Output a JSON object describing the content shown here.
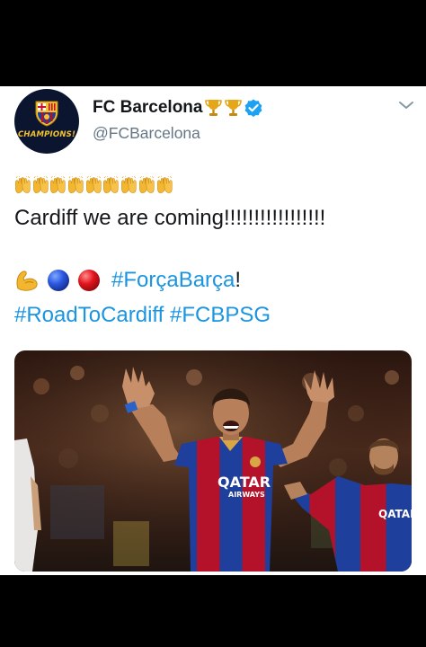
{
  "tweet": {
    "author": {
      "display_name": "FC Barcelona",
      "handle": "@FCBarcelona",
      "avatar_text": "CHAMPIONS!",
      "avatar_icon": "fc-barcelona-crest",
      "badges": [
        "trophy-icon",
        "trophy-icon",
        "verified-icon"
      ]
    },
    "menu_icon": "chevron-down-icon",
    "text": {
      "line1": "Cardiff we are coming!!!!!!!!!!!!!!!!!",
      "emojis": [
        "flexed-biceps-icon",
        "blue-circle-icon",
        "red-circle-icon"
      ],
      "hashtag1": "#ForçaBarça",
      "hashtag1_suffix": "!",
      "hashtag2": "#RoadToCardiff",
      "hashtag3": "#FCBPSG",
      "raised_hands_count": 9
    },
    "media": {
      "sponsor_text": "QATAR",
      "sponsor_sub": "AIRWAYS",
      "sponsor_text_2": "QATAR"
    }
  },
  "colors": {
    "background": "#000000",
    "card": "#ffffff",
    "name": "#14171a",
    "handle": "#657786",
    "link": "#1b95e0",
    "verified": "#1da1f2",
    "barca_blue": "#1f3f9c",
    "barca_red": "#b3122a"
  }
}
